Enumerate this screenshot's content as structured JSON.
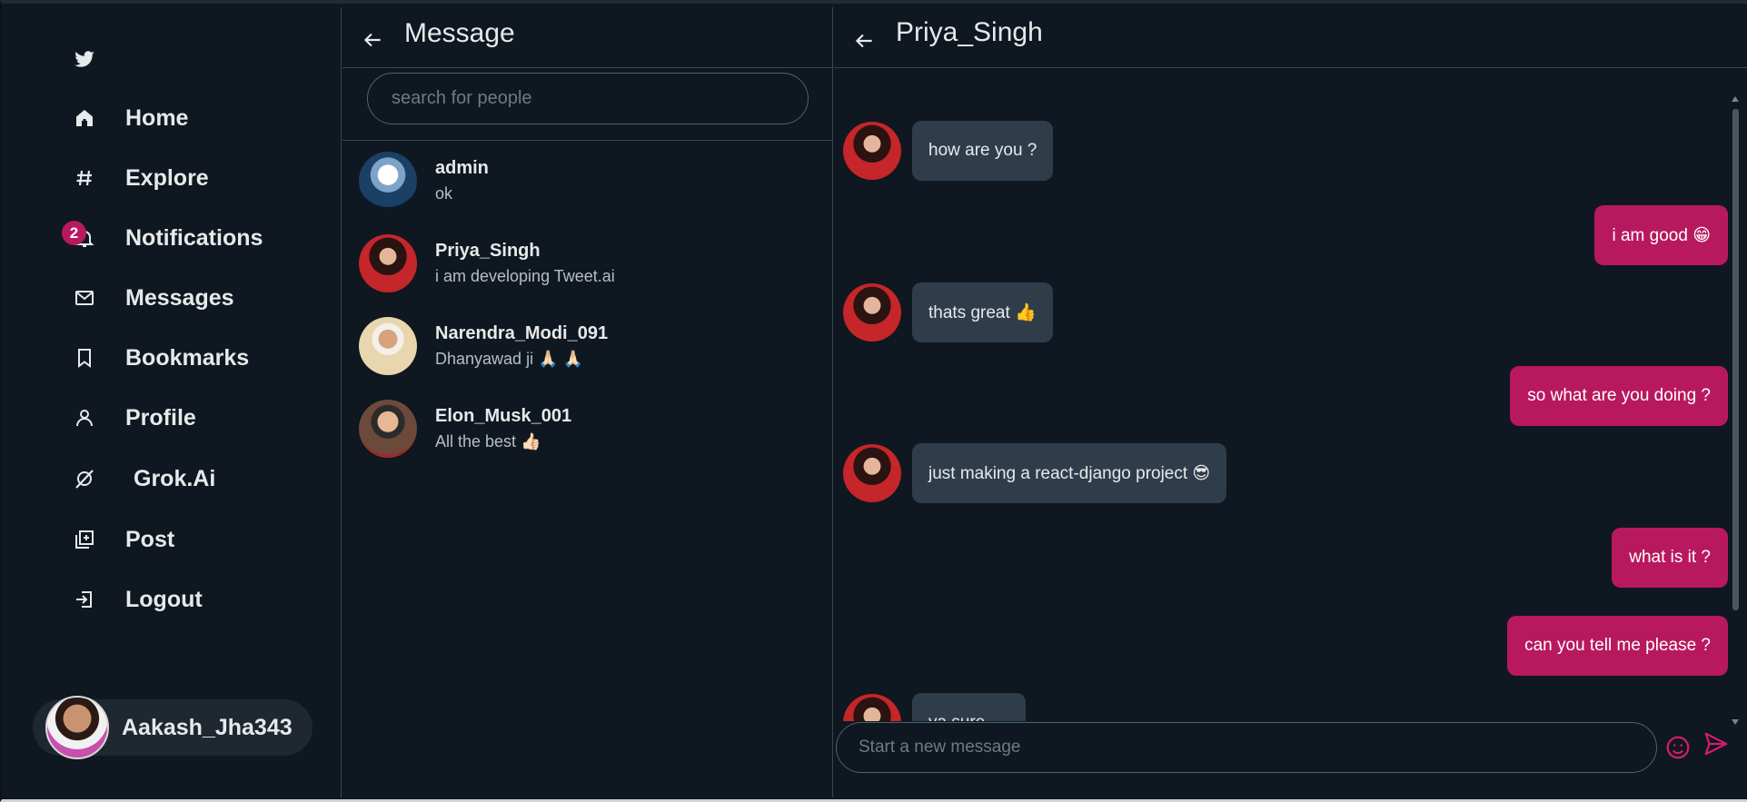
{
  "sidebar": {
    "logo_icon": "twitter-bird-icon",
    "items": [
      {
        "label": "Home",
        "icon": "home-icon"
      },
      {
        "label": "Explore",
        "icon": "hashtag-icon"
      },
      {
        "label": "Notifications",
        "icon": "bell-icon",
        "badge": "2"
      },
      {
        "label": "Messages",
        "icon": "mail-icon"
      },
      {
        "label": "Bookmarks",
        "icon": "bookmark-icon"
      },
      {
        "label": "Profile",
        "icon": "user-icon"
      },
      {
        "label": "Grok.Ai",
        "icon": "grok-icon"
      },
      {
        "label": "Post",
        "icon": "add-post-icon"
      },
      {
        "label": "Logout",
        "icon": "logout-icon"
      }
    ],
    "current_user": "Aakash_Jha343"
  },
  "messages_panel": {
    "title": "Message",
    "search_placeholder": "search for people",
    "conversations": [
      {
        "name": "admin",
        "last": "ok"
      },
      {
        "name": "Priya_Singh",
        "last": "i am developing Tweet.ai"
      },
      {
        "name": "Narendra_Modi_091",
        "last": "Dhanyawad ji 🙏🏻 🙏🏻"
      },
      {
        "name": "Elon_Musk_001",
        "last": "All the best 👍🏻"
      }
    ]
  },
  "chat": {
    "title": "Priya_Singh",
    "messages": [
      {
        "from": "them",
        "text": "how are you ?"
      },
      {
        "from": "me",
        "text": "i am good 😁"
      },
      {
        "from": "them",
        "text": "thats great 👍"
      },
      {
        "from": "me",
        "text": "so what are you doing ?"
      },
      {
        "from": "them",
        "text": "just making a react-django project 😎"
      },
      {
        "from": "me",
        "text": "what is it ?"
      },
      {
        "from": "me",
        "text": "can you tell me please ?"
      },
      {
        "from": "them",
        "text": "ya sure....."
      }
    ],
    "composer_placeholder": "Start a new message"
  },
  "colors": {
    "background": "#0f1720",
    "accent": "#b8195e",
    "incoming_bubble": "#2f3d4a",
    "border": "#3a4450"
  }
}
